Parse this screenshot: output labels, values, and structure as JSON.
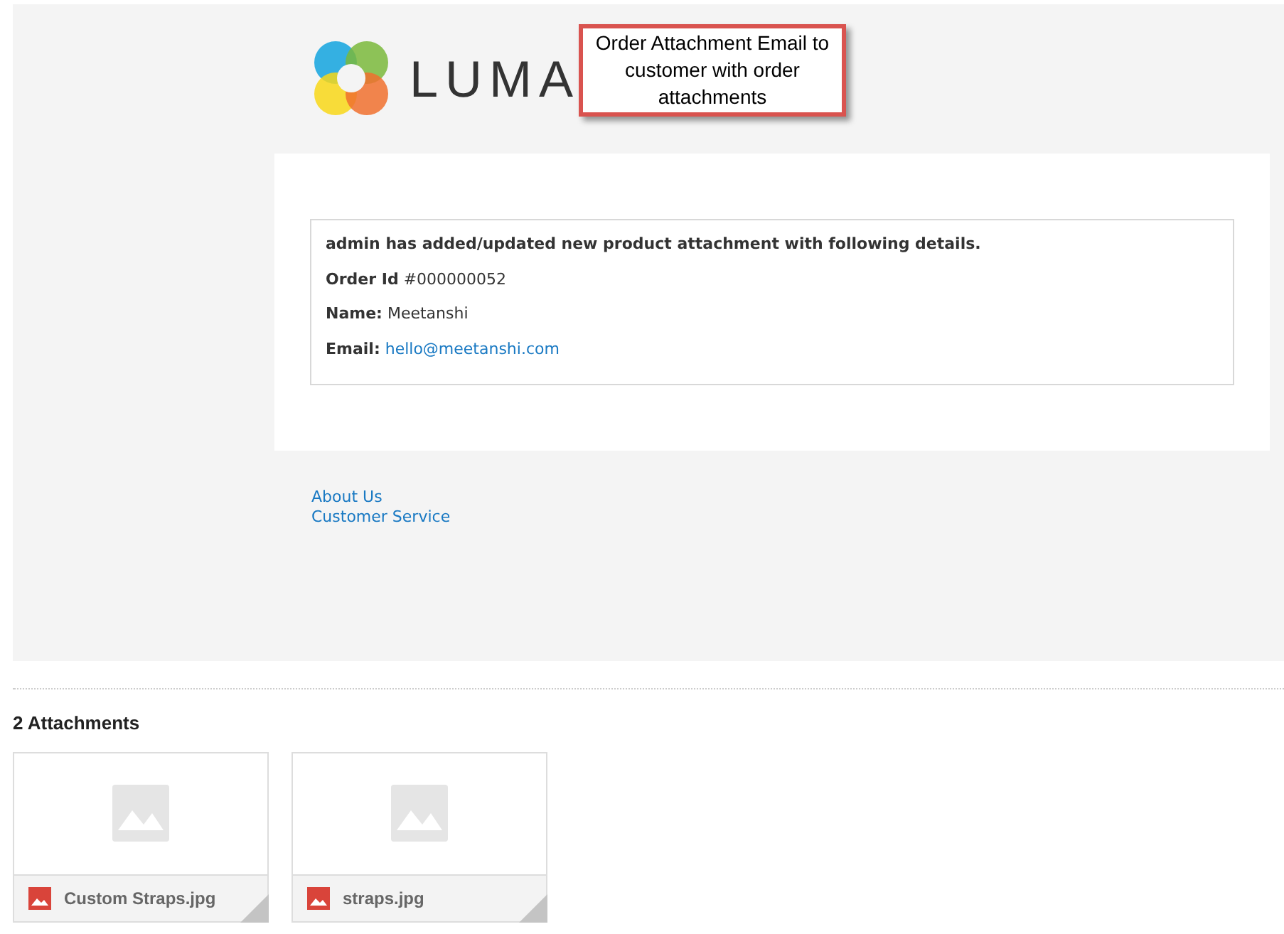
{
  "email_preview": {
    "logo_text": "LUMA",
    "callout": "Order Attachment Email to customer with order attachments",
    "lines": [
      {
        "kind": "heading",
        "text": "admin has added/updated new product attachment with following details."
      },
      {
        "kind": "field",
        "text": "**Order Id** #000000052"
      },
      {
        "kind": "field",
        "text": "**Name:** Meetanshi"
      },
      {
        "kind": "link_field",
        "label": "Email:",
        "link": "hello@meetanshi.com"
      }
    ],
    "footer_links": [
      "About Us",
      "Customer Service"
    ]
  },
  "attachments": {
    "heading": "2 Attachments",
    "files": [
      {
        "name": "Custom Straps.jpg"
      },
      {
        "name": "straps.jpg"
      }
    ]
  }
}
